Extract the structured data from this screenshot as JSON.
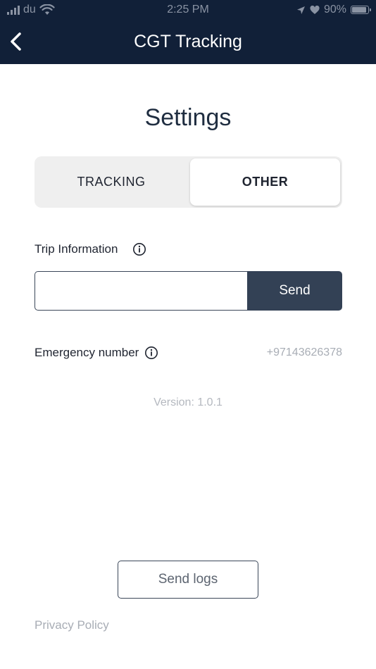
{
  "status_bar": {
    "carrier": "du",
    "time": "2:25 PM",
    "battery_percent": "90%",
    "battery_level": 0.9,
    "icons": [
      "signal-icon",
      "wifi-icon",
      "location-arrow-icon",
      "heart-icon",
      "battery-icon"
    ]
  },
  "nav": {
    "title": "CGT Tracking",
    "back_icon": "chevron-left-icon"
  },
  "page": {
    "title": "Settings"
  },
  "tabs": [
    {
      "label": "TRACKING",
      "selected": false
    },
    {
      "label": "OTHER",
      "selected": true
    }
  ],
  "trip": {
    "label": "Trip Information",
    "input_value": "",
    "input_placeholder": "",
    "send_label": "Send"
  },
  "emergency": {
    "label": "Emergency number",
    "value": "+97143626378"
  },
  "version": "Version: 1.0.1",
  "send_logs_label": "Send logs",
  "privacy_label": "Privacy Policy",
  "colors": {
    "header_bg": "#112038",
    "primary_button": "#334155",
    "muted_text": "#a8adb5"
  }
}
